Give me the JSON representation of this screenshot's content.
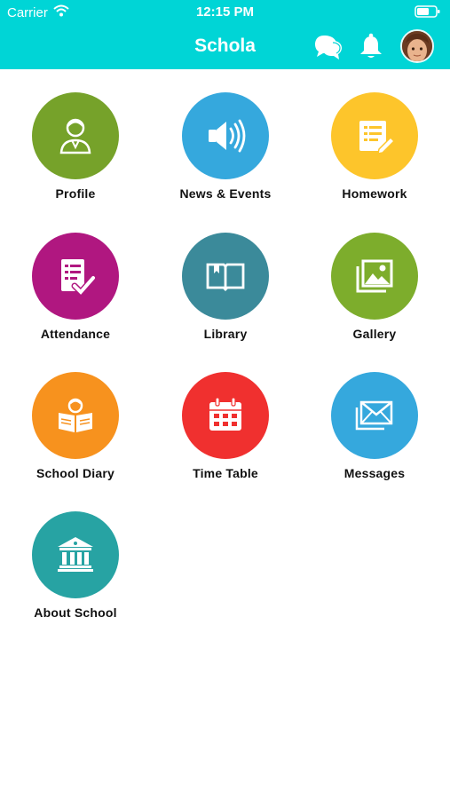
{
  "status_bar": {
    "carrier": "Carrier",
    "time": "12:15 PM"
  },
  "header": {
    "title": "Schola",
    "icons": [
      "chat-icon",
      "bell-icon",
      "avatar"
    ]
  },
  "menu": [
    {
      "label": "Profile",
      "icon": "profile-icon",
      "color": "#76a22a"
    },
    {
      "label": "News & Events",
      "icon": "speaker-icon",
      "color": "#35a8dd"
    },
    {
      "label": "Homework",
      "icon": "homework-icon",
      "color": "#fdc52b"
    },
    {
      "label": "Attendance",
      "icon": "attendance-icon",
      "color": "#b01780"
    },
    {
      "label": "Library",
      "icon": "book-icon",
      "color": "#3b8a9a"
    },
    {
      "label": "Gallery",
      "icon": "gallery-icon",
      "color": "#7dad2c"
    },
    {
      "label": "School Diary",
      "icon": "reading-icon",
      "color": "#f7921e"
    },
    {
      "label": "Time Table",
      "icon": "calendar-icon",
      "color": "#f0302f"
    },
    {
      "label": "Messages",
      "icon": "envelope-icon",
      "color": "#35a8dd"
    },
    {
      "label": "About School",
      "icon": "school-building-icon",
      "color": "#27a3a3"
    }
  ]
}
